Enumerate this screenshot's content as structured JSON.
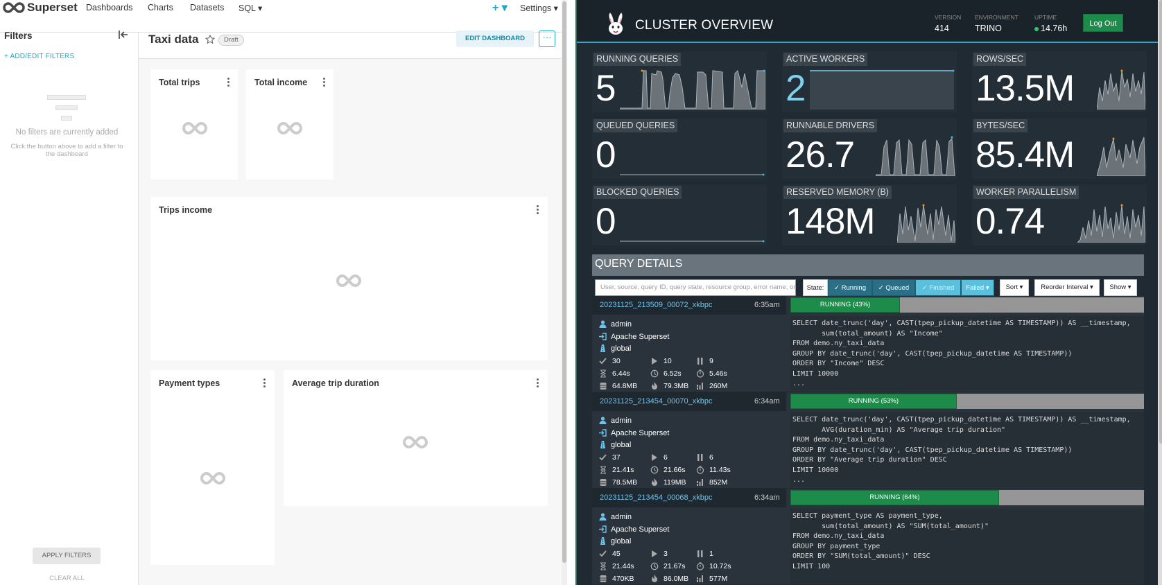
{
  "superset": {
    "brand": "Superset",
    "nav": {
      "menu": [
        "Dashboards",
        "Charts",
        "Datasets",
        "SQL ▾"
      ],
      "plus_label": "+ ▾",
      "settings_label": "Settings ▾"
    },
    "filters": {
      "title": "Filters",
      "add_label": "+ ADD/EDIT FILTERS",
      "empty_title": "No filters are currently added",
      "empty_sub": "Click the button above to add a filter to the dashboard",
      "apply_label": "APPLY FILTERS",
      "clear_label": "CLEAR ALL"
    },
    "dashboard": {
      "title": "Taxi data",
      "badge": "Draft",
      "edit_label": "EDIT DASHBOARD",
      "more_label": "···",
      "charts": [
        "Total trips",
        "Total income",
        "Trips income",
        "Payment types",
        "Average trip duration"
      ]
    }
  },
  "trino": {
    "title": "CLUSTER OVERVIEW",
    "meta": [
      {
        "key": "VERSION",
        "value": "414"
      },
      {
        "key": "ENVIRONMENT",
        "value": "TRINO"
      },
      {
        "key": "UPTIME",
        "value": "14.76h"
      }
    ],
    "logout_label": "Log Out",
    "metrics": [
      {
        "label": "RUNNING QUERIES",
        "value": "5"
      },
      {
        "label": "ACTIVE WORKERS",
        "value": "2"
      },
      {
        "label": "ROWS/SEC",
        "value": "13.5M"
      },
      {
        "label": "QUEUED QUERIES",
        "value": "0"
      },
      {
        "label": "RUNNABLE DRIVERS",
        "value": "26.7"
      },
      {
        "label": "BYTES/SEC",
        "value": "85.4M"
      },
      {
        "label": "BLOCKED QUERIES",
        "value": "0"
      },
      {
        "label": "RESERVED MEMORY (B)",
        "value": "148M"
      },
      {
        "label": "WORKER PARALLELISM",
        "value": "0.74"
      }
    ],
    "query_details": {
      "title": "QUERY DETAILS",
      "search_placeholder": "User, source, query ID, query state, resource group, error name, or query text",
      "state_label": "State:",
      "states": [
        "✓ Running",
        "✓ Queued",
        "✓ Finished",
        "Failed ▾"
      ],
      "sort_label": "Sort ▾",
      "reorder_label": "Reorder Interval ▾",
      "show_label": "Show ▾"
    },
    "queries": [
      {
        "id": "20231125_213509_00072_xkbpc",
        "time": "6:35am",
        "progress_label": "RUNNING (43%)",
        "progress": 0.31,
        "user": "admin",
        "source": "Apache Superset",
        "group": "global",
        "stats": [
          "30",
          "10",
          "9",
          "6.44s",
          "6.52s",
          "5.46s",
          "64.8MB",
          "79.3MB",
          "260M"
        ],
        "sql": "SELECT date_trunc('day', CAST(tpep_pickup_datetime AS TIMESTAMP)) AS __timestamp,\n       sum(total_amount) AS \"Income\"\nFROM demo.ny_taxi_data\nGROUP BY date_trunc('day', CAST(tpep_pickup_datetime AS TIMESTAMP))\nORDER BY \"Income\" DESC\nLIMIT 10000\n..."
      },
      {
        "id": "20231125_213454_00070_xkbpc",
        "time": "6:34am",
        "progress_label": "RUNNING (53%)",
        "progress": 0.47,
        "user": "admin",
        "source": "Apache Superset",
        "group": "global",
        "stats": [
          "37",
          "6",
          "6",
          "21.41s",
          "21.66s",
          "11.43s",
          "78.5MB",
          "119MB",
          "852M"
        ],
        "sql": "SELECT date_trunc('day', CAST(tpep_pickup_datetime AS TIMESTAMP)) AS __timestamp,\n       AVG(duration_min) AS \"Average trip duration\"\nFROM demo.ny_taxi_data\nGROUP BY date_trunc('day', CAST(tpep_pickup_datetime AS TIMESTAMP))\nORDER BY \"Average trip duration\" DESC\nLIMIT 10000\n..."
      },
      {
        "id": "20231125_213454_00068_xkbpc",
        "time": "6:34am",
        "progress_label": "RUNNING (64%)",
        "progress": 0.59,
        "user": "admin",
        "source": "Apache Superset",
        "group": "global",
        "stats": [
          "45",
          "3",
          "1",
          "21.44s",
          "21.67s",
          "10.72s",
          "470KB",
          "86.0MB",
          "577M"
        ],
        "sql": "SELECT payment_type AS payment_type,\n       sum(total_amount) AS \"SUM(total_amount)\"\nFROM demo.ny_taxi_data\nGROUP BY payment_type\nORDER BY \"SUM(total_amount)\" DESC\nLIMIT 100"
      }
    ]
  }
}
